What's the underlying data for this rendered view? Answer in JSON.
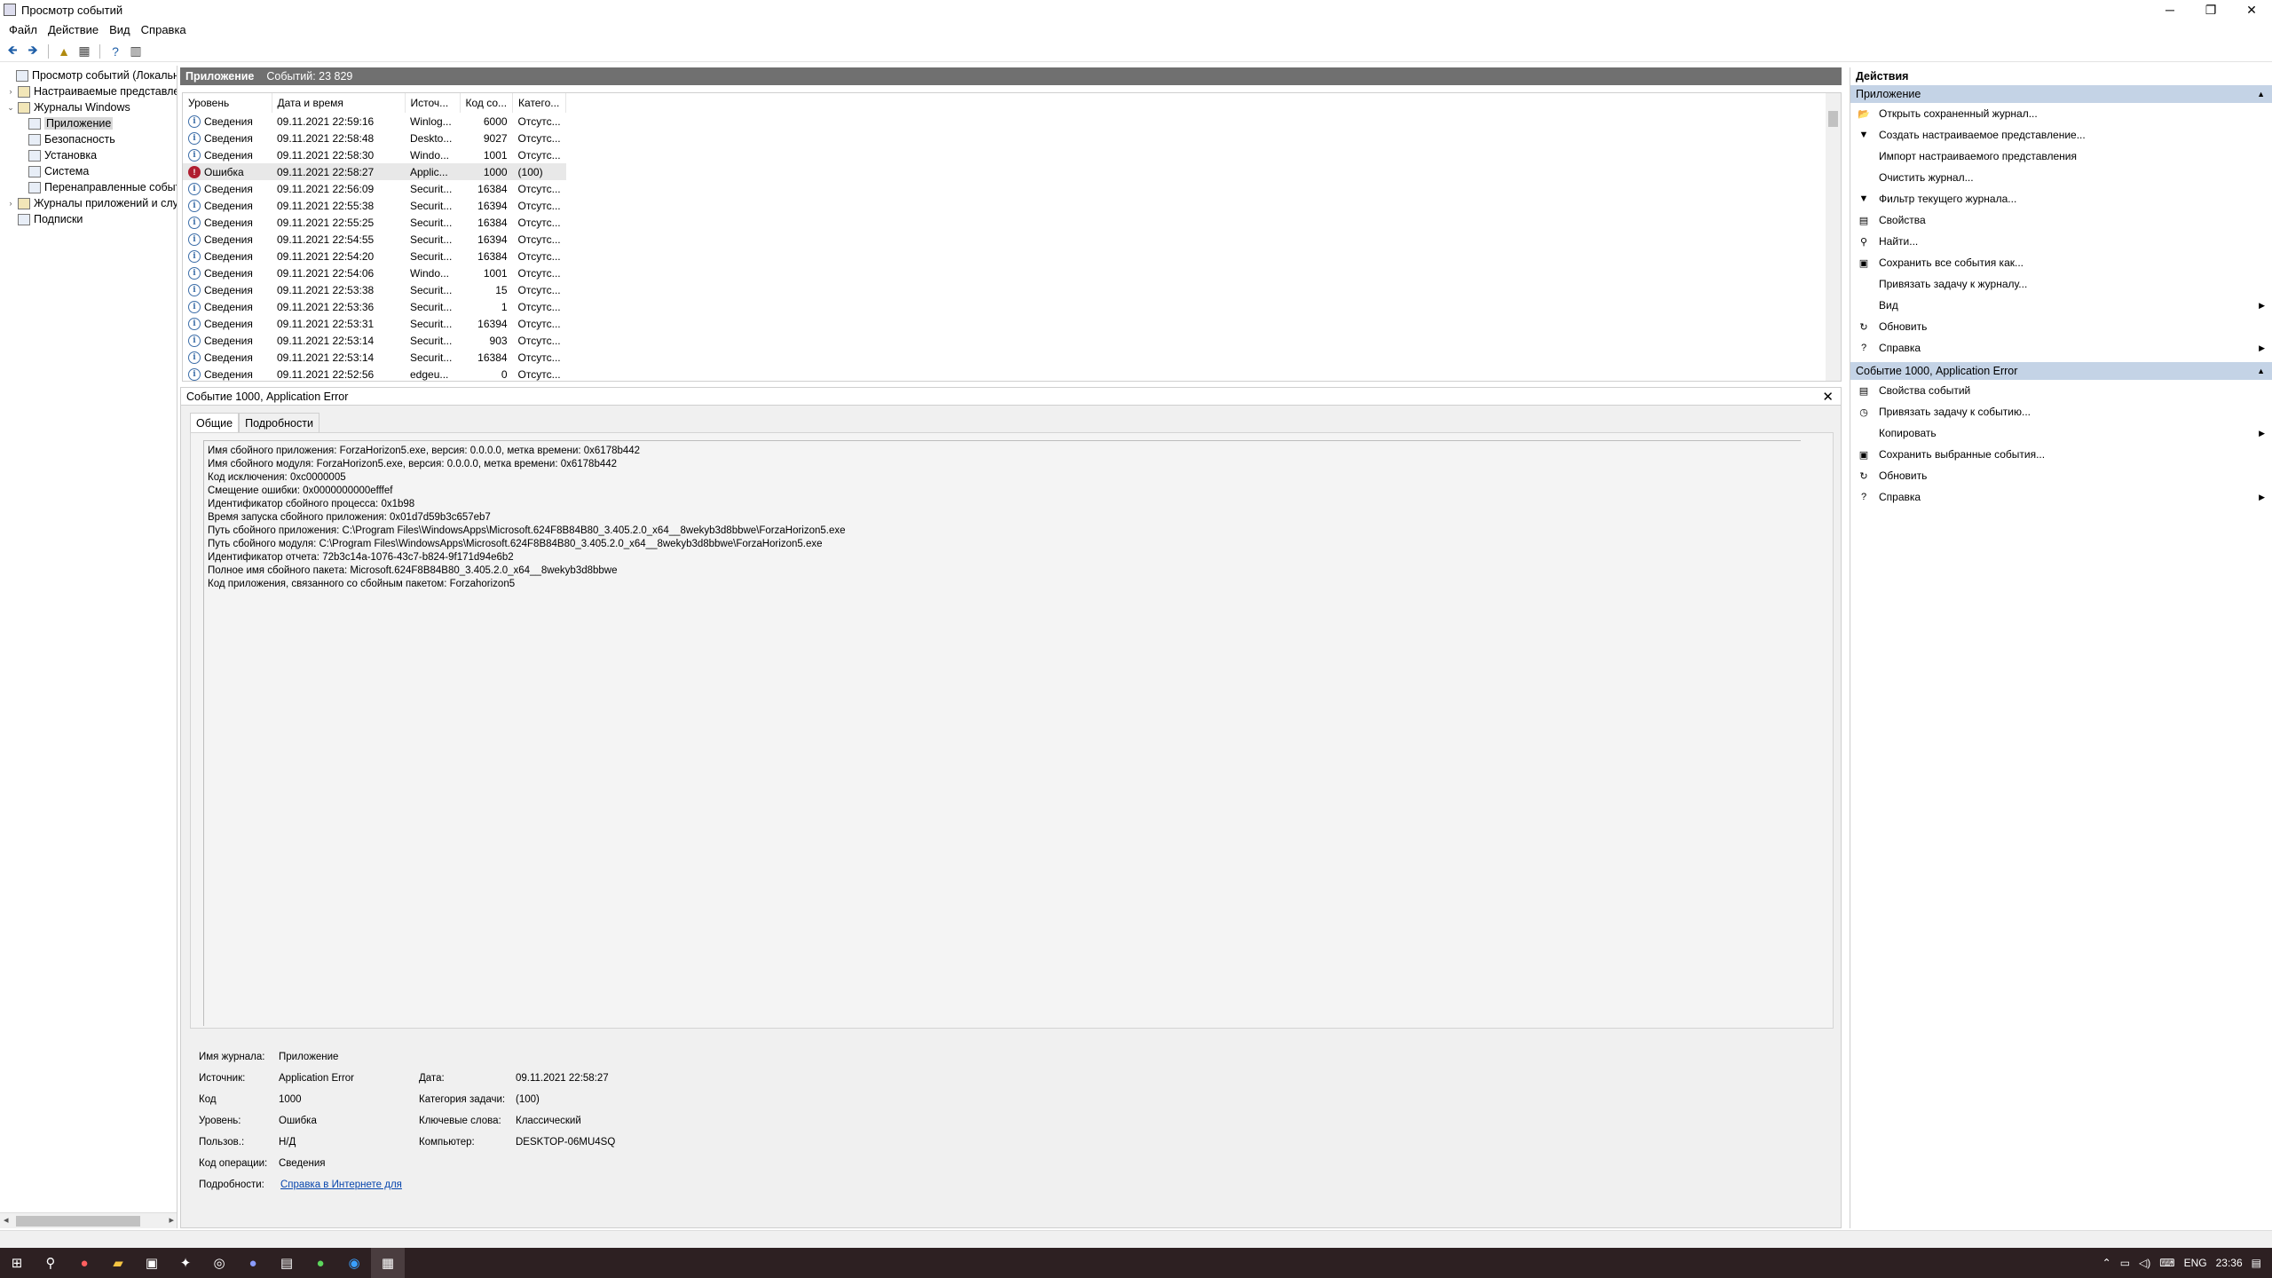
{
  "window": {
    "title": "Просмотр событий"
  },
  "menu": [
    "Файл",
    "Действие",
    "Вид",
    "Справка"
  ],
  "tree": [
    {
      "label": "Просмотр событий (Локальный)",
      "level": 0,
      "exp": ""
    },
    {
      "label": "Настраиваемые представления",
      "level": 1,
      "exp": "›"
    },
    {
      "label": "Журналы Windows",
      "level": 1,
      "exp": "⌄"
    },
    {
      "label": "Приложение",
      "level": 2,
      "exp": "",
      "selected": true
    },
    {
      "label": "Безопасность",
      "level": 2,
      "exp": ""
    },
    {
      "label": "Установка",
      "level": 2,
      "exp": ""
    },
    {
      "label": "Система",
      "level": 2,
      "exp": ""
    },
    {
      "label": "Перенаправленные события",
      "level": 2,
      "exp": ""
    },
    {
      "label": "Журналы приложений и служб",
      "level": 1,
      "exp": "›"
    },
    {
      "label": "Подписки",
      "level": 1,
      "exp": ""
    }
  ],
  "center": {
    "title": "Приложение",
    "count": "Событий: 23 829"
  },
  "events": {
    "columns": [
      "Уровень",
      "Дата и время",
      "Источ...",
      "Код со...",
      "Катего..."
    ],
    "rows": [
      {
        "level": "Сведения",
        "type": "info",
        "date": "09.11.2021 22:59:16",
        "source": "Winlog...",
        "code": "6000",
        "cat": "Отсутс..."
      },
      {
        "level": "Сведения",
        "type": "info",
        "date": "09.11.2021 22:58:48",
        "source": "Deskto...",
        "code": "9027",
        "cat": "Отсутс..."
      },
      {
        "level": "Сведения",
        "type": "info",
        "date": "09.11.2021 22:58:30",
        "source": "Windo...",
        "code": "1001",
        "cat": "Отсутс..."
      },
      {
        "level": "Ошибка",
        "type": "error",
        "date": "09.11.2021 22:58:27",
        "source": "Applic...",
        "code": "1000",
        "cat": "(100)",
        "selected": true
      },
      {
        "level": "Сведения",
        "type": "info",
        "date": "09.11.2021 22:56:09",
        "source": "Securit...",
        "code": "16384",
        "cat": "Отсутс..."
      },
      {
        "level": "Сведения",
        "type": "info",
        "date": "09.11.2021 22:55:38",
        "source": "Securit...",
        "code": "16394",
        "cat": "Отсутс..."
      },
      {
        "level": "Сведения",
        "type": "info",
        "date": "09.11.2021 22:55:25",
        "source": "Securit...",
        "code": "16384",
        "cat": "Отсутс..."
      },
      {
        "level": "Сведения",
        "type": "info",
        "date": "09.11.2021 22:54:55",
        "source": "Securit...",
        "code": "16394",
        "cat": "Отсутс..."
      },
      {
        "level": "Сведения",
        "type": "info",
        "date": "09.11.2021 22:54:20",
        "source": "Securit...",
        "code": "16384",
        "cat": "Отсутс..."
      },
      {
        "level": "Сведения",
        "type": "info",
        "date": "09.11.2021 22:54:06",
        "source": "Windo...",
        "code": "1001",
        "cat": "Отсутс..."
      },
      {
        "level": "Сведения",
        "type": "info",
        "date": "09.11.2021 22:53:38",
        "source": "Securit...",
        "code": "15",
        "cat": "Отсутс..."
      },
      {
        "level": "Сведения",
        "type": "info",
        "date": "09.11.2021 22:53:36",
        "source": "Securit...",
        "code": "1",
        "cat": "Отсутс..."
      },
      {
        "level": "Сведения",
        "type": "info",
        "date": "09.11.2021 22:53:31",
        "source": "Securit...",
        "code": "16394",
        "cat": "Отсутс..."
      },
      {
        "level": "Сведения",
        "type": "info",
        "date": "09.11.2021 22:53:14",
        "source": "Securit...",
        "code": "903",
        "cat": "Отсутс..."
      },
      {
        "level": "Сведения",
        "type": "info",
        "date": "09.11.2021 22:53:14",
        "source": "Securit...",
        "code": "16384",
        "cat": "Отсутс..."
      },
      {
        "level": "Сведения",
        "type": "info",
        "date": "09.11.2021 22:52:56",
        "source": "edgeu...",
        "code": "0",
        "cat": "Отсутс..."
      }
    ]
  },
  "detail": {
    "header": "Событие 1000, Application Error",
    "tabs": [
      "Общие",
      "Подробности"
    ],
    "description": [
      "Имя сбойного приложения: ForzaHorizon5.exe, версия: 0.0.0.0, метка времени: 0x6178b442",
      "Имя сбойного модуля: ForzaHorizon5.exe, версия: 0.0.0.0, метка времени: 0x6178b442",
      "Код исключения: 0xc0000005",
      "Смещение ошибки: 0x0000000000efffef",
      "Идентификатор сбойного процесса: 0x1b98",
      "Время запуска сбойного приложения: 0x01d7d59b3c657eb7",
      "Путь сбойного приложения: C:\\Program Files\\WindowsApps\\Microsoft.624F8B84B80_3.405.2.0_x64__8wekyb3d8bbwe\\ForzaHorizon5.exe",
      "Путь сбойного модуля: C:\\Program Files\\WindowsApps\\Microsoft.624F8B84B80_3.405.2.0_x64__8wekyb3d8bbwe\\ForzaHorizon5.exe",
      "Идентификатор отчета: 72b3c14a-1076-43c7-b824-9f171d94e6b2",
      "Полное имя сбойного пакета: Microsoft.624F8B84B80_3.405.2.0_x64__8wekyb3d8bbwe",
      "Код приложения, связанного со сбойным пакетом: Forzahorizon5"
    ],
    "fields": {
      "log_label": "Имя журнала:",
      "log_value": "Приложение",
      "source_label": "Источник:",
      "source_value": "Application Error",
      "date_label": "Дата:",
      "date_value": "09.11.2021 22:58:27",
      "code_label": "Код",
      "code_value": "1000",
      "taskcat_label": "Категория задачи:",
      "taskcat_value": "(100)",
      "level_label": "Уровень:",
      "level_value": "Ошибка",
      "keywords_label": "Ключевые слова:",
      "keywords_value": "Классический",
      "user_label": "Пользов.:",
      "user_value": "Н/Д",
      "computer_label": "Компьютер:",
      "computer_value": "DESKTOP-06MU4SQ",
      "opcode_label": "Код операции:",
      "opcode_value": "Сведения",
      "more_label": "Подробности:",
      "more_link": "Справка в Интернете для"
    }
  },
  "actions": {
    "title": "Действия",
    "section1": "Приложение",
    "items1": [
      {
        "label": "Открыть сохраненный журнал...",
        "icon": "📂",
        "sub": false
      },
      {
        "label": "Создать настраиваемое представление...",
        "icon": "▼",
        "sub": false
      },
      {
        "label": "Импорт настраиваемого представления",
        "icon": "",
        "sub": false
      },
      {
        "label": "Очистить журнал...",
        "icon": "",
        "sub": false
      },
      {
        "label": "Фильтр текущего журнала...",
        "icon": "▼",
        "sub": false
      },
      {
        "label": "Свойства",
        "icon": "▤",
        "sub": false
      },
      {
        "label": "Найти...",
        "icon": "⚲",
        "sub": false
      },
      {
        "label": "Сохранить все события как...",
        "icon": "▣",
        "sub": false
      },
      {
        "label": "Привязать задачу к журналу...",
        "icon": "",
        "sub": false
      },
      {
        "label": "Вид",
        "icon": "",
        "sub": true
      },
      {
        "label": "Обновить",
        "icon": "↻",
        "sub": false
      },
      {
        "label": "Справка",
        "icon": "?",
        "sub": true
      }
    ],
    "section2": "Событие 1000, Application Error",
    "items2": [
      {
        "label": "Свойства событий",
        "icon": "▤",
        "sub": false
      },
      {
        "label": "Привязать задачу к событию...",
        "icon": "◷",
        "sub": false
      },
      {
        "label": "Копировать",
        "icon": "",
        "sub": true
      },
      {
        "label": "Сохранить выбранные события...",
        "icon": "▣",
        "sub": false
      },
      {
        "label": "Обновить",
        "icon": "↻",
        "sub": false
      },
      {
        "label": "Справка",
        "icon": "?",
        "sub": true
      }
    ]
  },
  "tray": {
    "lang": "ENG",
    "time": "23:36"
  }
}
